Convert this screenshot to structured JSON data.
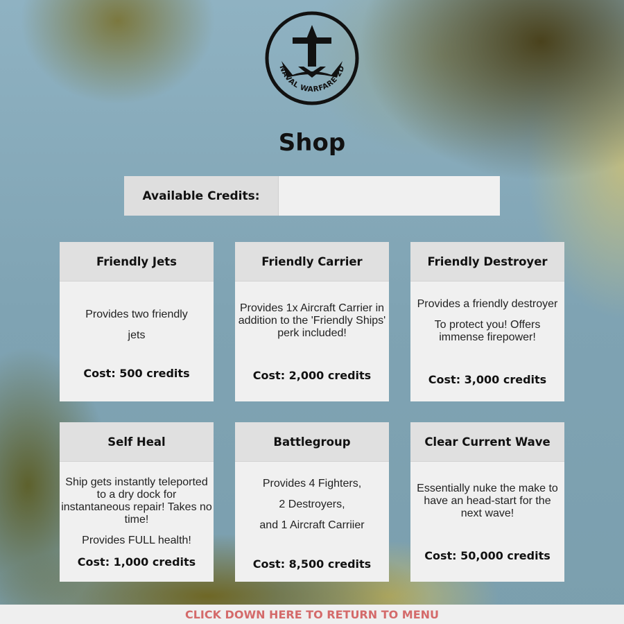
{
  "logo": {
    "text": "NAVAL WARFARE 2D"
  },
  "page_title": "Shop",
  "credits": {
    "label": "Available Credits:",
    "value": ""
  },
  "cards": [
    {
      "title": "Friendly Jets",
      "desc": [
        "Provides two friendly",
        "jets"
      ],
      "cost": "Cost: 500 credits"
    },
    {
      "title": "Friendly Carrier",
      "desc": [
        "Provides 1x Aircraft Carrier in addition to the 'Friendly Ships' perk included!"
      ],
      "cost": "Cost: 2,000 credits"
    },
    {
      "title": "Friendly Destroyer",
      "desc": [
        "Provides a friendly destroyer",
        "To protect you! Offers immense firepower!"
      ],
      "cost": "Cost: 3,000 credits"
    },
    {
      "title": "Self Heal",
      "desc": [
        "Ship gets instantly teleported to a dry dock for instantaneous repair! Takes no time!",
        "Provides FULL health!"
      ],
      "cost": "Cost: 1,000 credits"
    },
    {
      "title": "Battlegroup",
      "desc": [
        "Provides 4 Fighters,",
        "2 Destroyers,",
        "and 1 Aircraft Carriier"
      ],
      "cost": "Cost: 8,500  credits"
    },
    {
      "title": "Clear Current Wave",
      "desc": [
        "Essentially nuke the make to have an head-start for the next wave!"
      ],
      "cost": "Cost: 50,000 credits"
    }
  ],
  "footer": {
    "label": "CLICK DOWN HERE TO RETURN TO MENU"
  }
}
